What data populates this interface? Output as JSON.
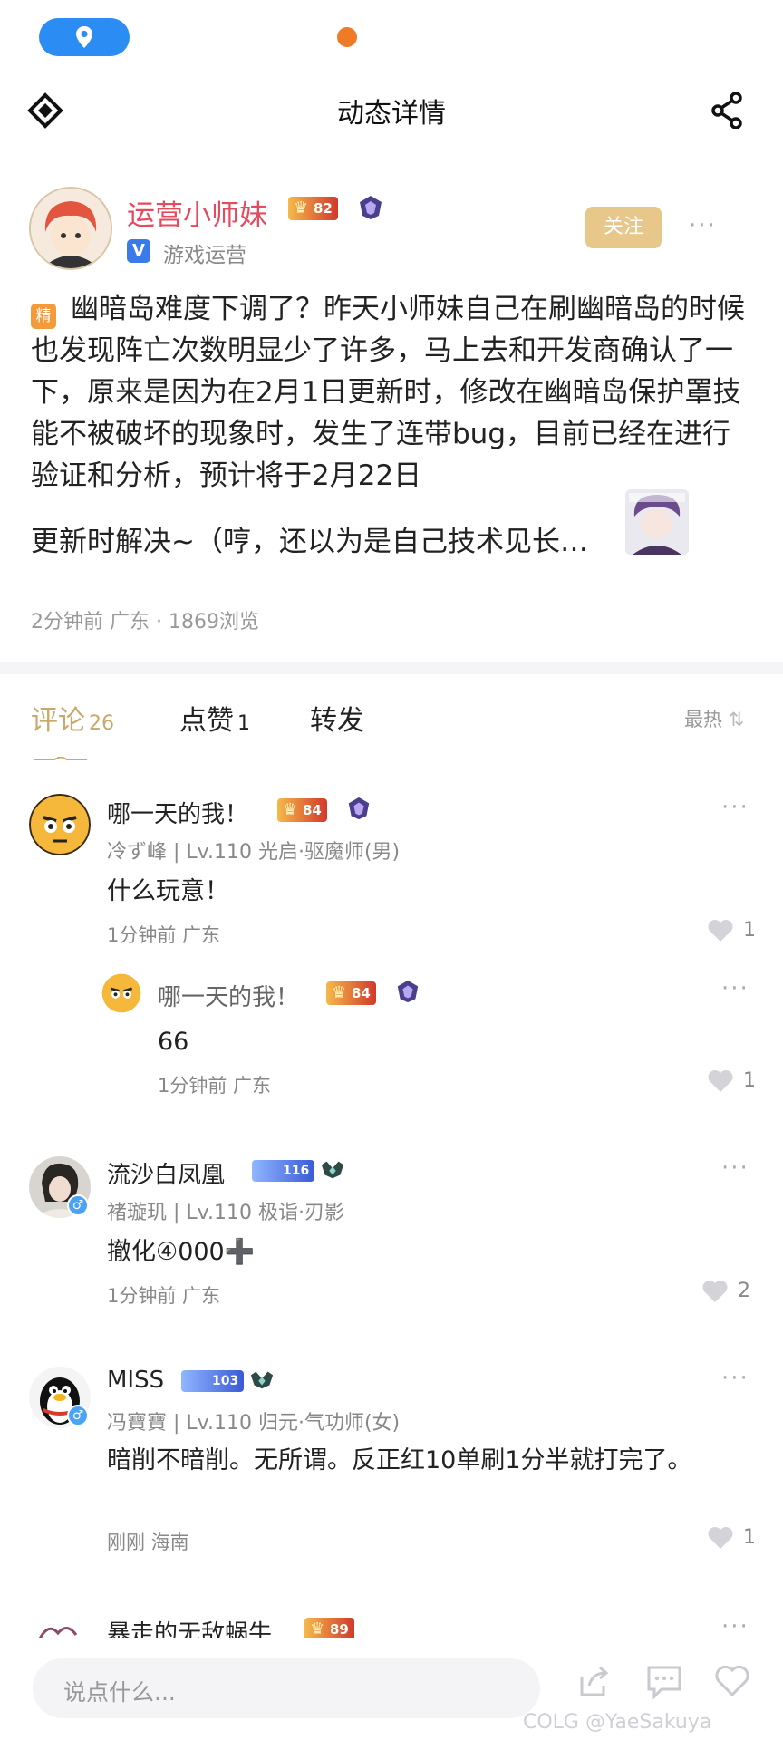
{
  "status_bar": {
    "location_icon": "location-pin-icon"
  },
  "header": {
    "title": "动态详情",
    "back_icon": "logo-back-icon",
    "share_icon": "share-icon"
  },
  "author": {
    "name": "运营小师妹",
    "level": "82",
    "verified_label": "V",
    "role": "游戏运营",
    "follow_label": "关注",
    "more_label": "···"
  },
  "post": {
    "badge": "精",
    "text": "幽暗岛难度下调了？昨天小师妹自己在刷幽暗岛的时候也发现阵亡次数明显少了许多，马上去和开发商确认了一下，原来是因为在2月1日更新时，修改在幽暗岛保护罩技能不被破坏的现象时，发生了连带bug，目前已经在进行验证和分析，预计将于2月22日",
    "text_tail": "更新时解决~（哼，还以为是自己技术见长…",
    "meta": "2分钟前  广东 · 1869浏览"
  },
  "tabs": [
    {
      "label": "评论",
      "count": "26"
    },
    {
      "label": "点赞",
      "count": "1"
    },
    {
      "label": "转发",
      "count": ""
    }
  ],
  "sort_label": "最热",
  "comments": [
    {
      "name": "哪一天的我！",
      "level": "84",
      "sub": "冷ず峰 | Lv.110 光启·驱魔师(男)",
      "body": "什么玩意！",
      "time": "1分钟前  广东",
      "likes": "1",
      "reply": {
        "name": "哪一天的我！",
        "level": "84",
        "body": "66",
        "time": "1分钟前  广东",
        "likes": "1"
      }
    },
    {
      "name": "流沙白凤凰",
      "level": "116",
      "sub": "褚璇玑 | Lv.110 极诣·刃影",
      "body": "撤化④000➕",
      "time": "1分钟前  广东",
      "likes": "2"
    },
    {
      "name": "MISS",
      "level": "103",
      "sub": "冯寶寶 | Lv.110 归元·气功师(女)",
      "body": "暗削不暗削。无所谓。反正红10单刷1分半就打完了。",
      "time": "刚刚  海南",
      "likes": "1"
    },
    {
      "name": "暴走的无敌蜗牛",
      "level": "89"
    }
  ],
  "bottom_bar": {
    "placeholder": "说点什么...",
    "watermark": "COLG @YaeSakuya"
  },
  "colors": {
    "accent_gold": "#c9a86a",
    "author_name": "#e54b5f",
    "follow_bg": "#e7c78a",
    "location_pill": "#2b8cf3"
  }
}
